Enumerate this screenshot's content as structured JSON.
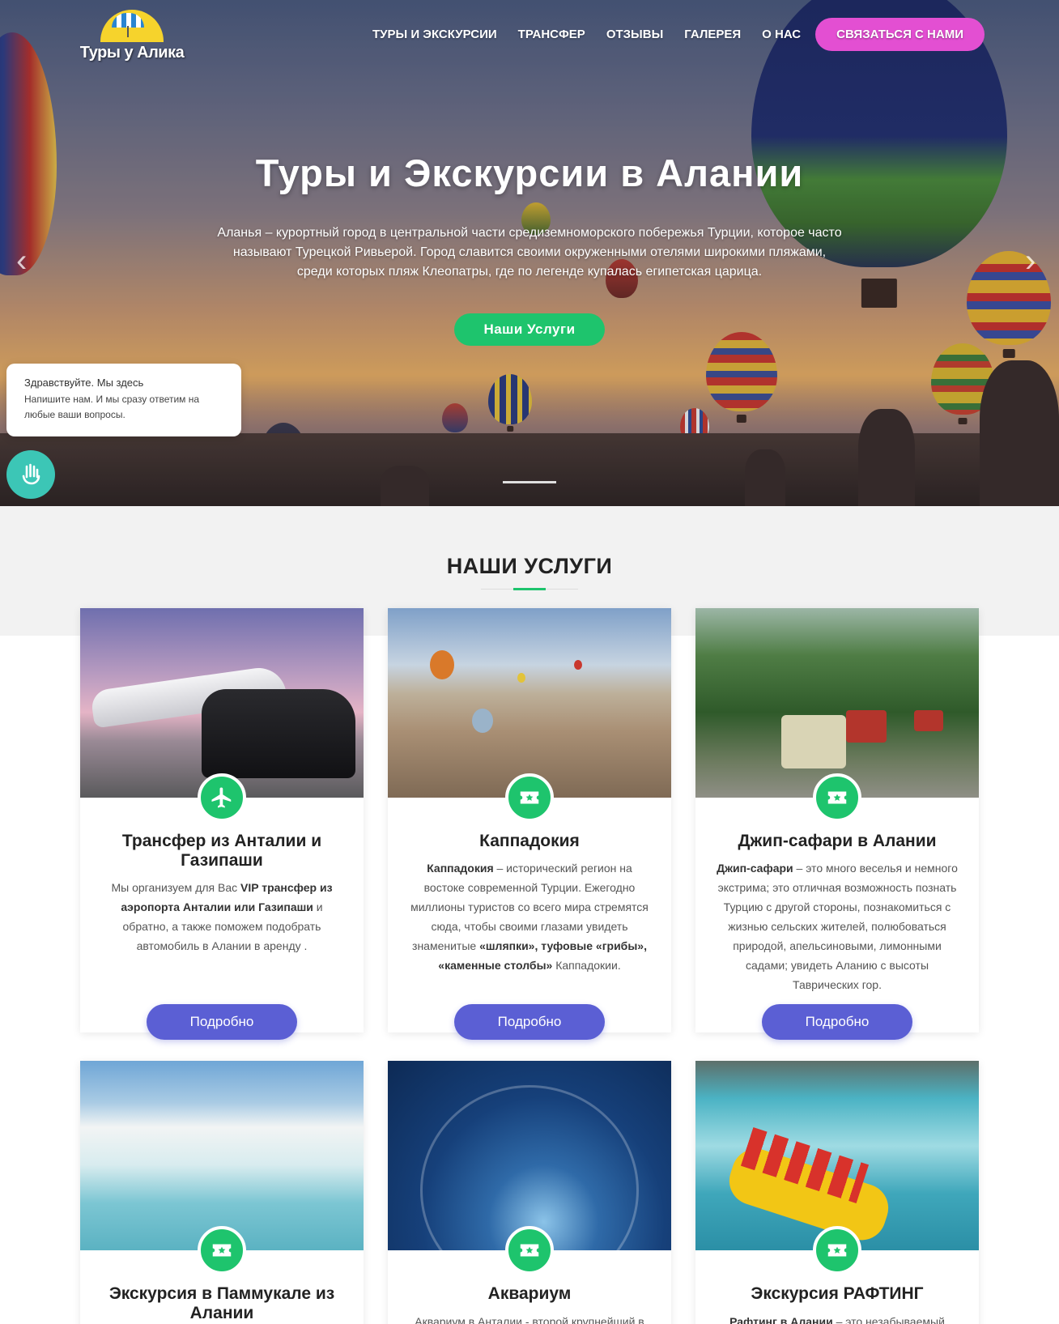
{
  "brand": {
    "logo_text": "Туры у Алика"
  },
  "nav": {
    "items": [
      {
        "label": "ТУРЫ И ЭКСКУРСИИ"
      },
      {
        "label": "ТРАНСФЕР"
      },
      {
        "label": "ОТЗЫВЫ"
      },
      {
        "label": "ГАЛЕРЕЯ"
      },
      {
        "label": "О НАС"
      }
    ],
    "cta_label": "СВЯЗАТЬСЯ С НАМИ"
  },
  "hero": {
    "title": "Туры и Экскурсии в Алании",
    "description": "Аланья – курортный город в центральной части средиземноморского побережья Турции, которое часто называют Турецкой Ривьерой. Город славится своими окруженными отелями широкими пляжами, среди которых пляж Клеопатры, где по легенде купалась египетская царица.",
    "button_label": "Наши Услуги",
    "prev_arrow": "‹",
    "next_arrow": "›"
  },
  "chat": {
    "greeting": "Здравствуйте. Мы здесь",
    "message": "Напишите нам. И мы сразу ответим на любые ваши вопросы.",
    "icon": "hand-wave-icon"
  },
  "services": {
    "title": "НАШИ УСЛУГИ",
    "more_label": "Подробно",
    "cards": [
      {
        "title": "Трансфер из Анталии и Газипаши",
        "icon": "airplane-icon",
        "desc_parts": [
          "Мы организуем для Вас ",
          "VIP трансфер из аэропорта Анталии или Газипаши",
          " и обратно, а также поможем подобрать автомобиль в Алании в аренду ."
        ]
      },
      {
        "title": "Каппадокия",
        "icon": "ticket-star-icon",
        "desc_parts": [
          "Каппадокия",
          " – исторический регион на востоке современной Турции. Ежегодно миллионы туристов со всего мира стремятся сюда, чтобы своими глазами увидеть знаменитые ",
          "«шляпки», туфовые «грибы», «каменные столбы»",
          " Каппадокии."
        ]
      },
      {
        "title": "Джип-сафари в Алании",
        "icon": "ticket-star-icon",
        "desc_parts": [
          "Джип-сафари",
          " – это много веселья и немного экстрима; это отличная возможность познать Турцию с другой стороны, познакомиться с жизнью сельских жителей, полюбоваться природой, апельсиновыми, лимонными садами; увидеть Аланию с высоты Таврических гор."
        ]
      },
      {
        "title": "Экскурсия в Паммукале из Алании",
        "icon": "ticket-star-icon",
        "desc_parts": []
      },
      {
        "title": "Аквариум",
        "icon": "ticket-star-icon",
        "desc_parts": [
          "Аквариум в Анталии - второй крупнейший в"
        ]
      },
      {
        "title": "Экскурсия РАФТИНГ",
        "icon": "ticket-star-icon",
        "desc_parts": [
          "Рафтинг в Алании",
          " – это незабываемый"
        ]
      }
    ]
  },
  "colors": {
    "accent_green": "#1ec46d",
    "cta_pink": "#e34fd2",
    "button_purple": "#5b5fd4",
    "chat_teal": "#3cc6b6"
  }
}
